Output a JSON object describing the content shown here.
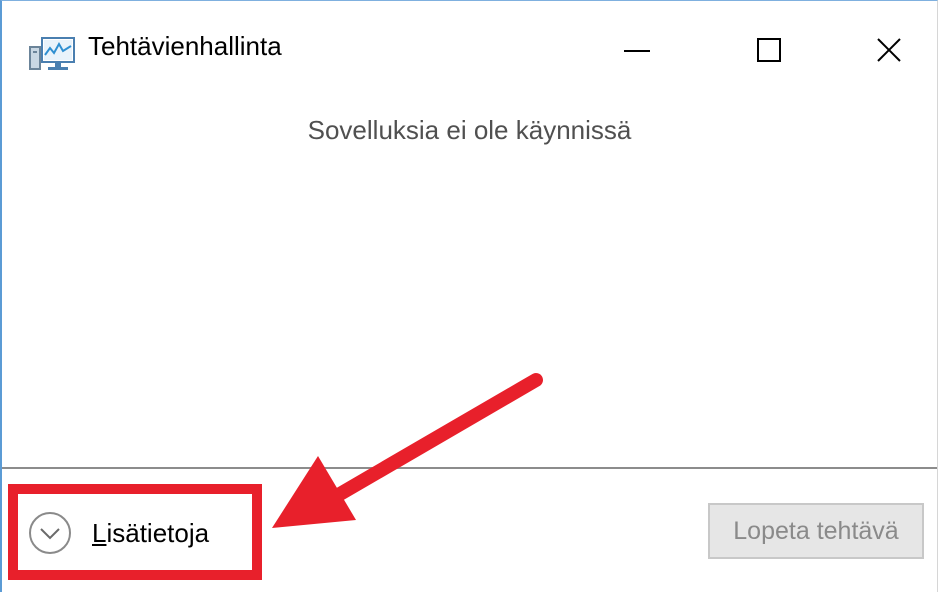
{
  "window": {
    "title": "Tehtävienhallinta",
    "app_icon": "task-manager-icon",
    "controls": {
      "minimize_icon": "minimize-icon",
      "maximize_icon": "maximize-icon",
      "close_icon": "close-icon"
    }
  },
  "main": {
    "empty_message": "Sovelluksia ei ole käynnissä"
  },
  "footer": {
    "more_details_label": "Lisätietoja",
    "more_details_icon": "chevron-down-circle-icon",
    "end_task_label": "Lopeta tehtävä",
    "end_task_enabled": false
  },
  "annotation": {
    "color": "#e8202b",
    "highlight": "red-box-around-more-details",
    "arrow": "red-arrow-pointing-to-more-details"
  }
}
